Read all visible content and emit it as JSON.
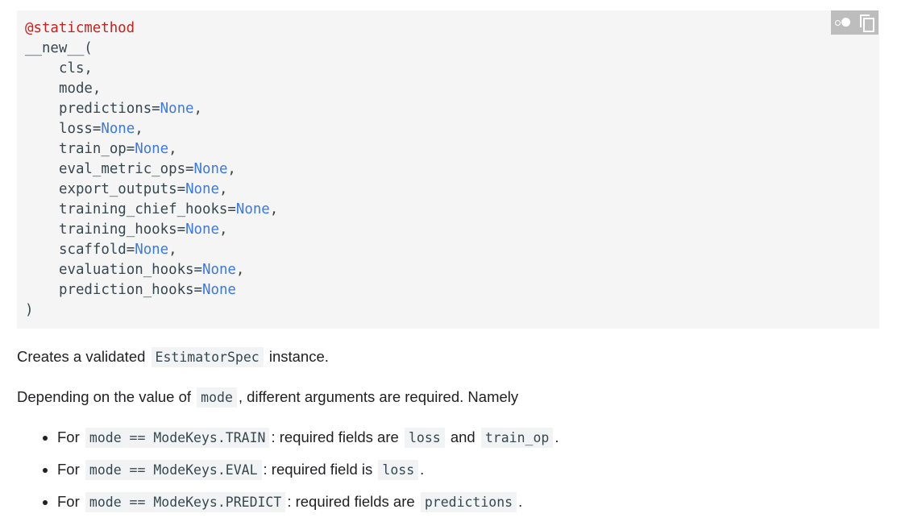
{
  "code": {
    "decorator": "@staticmethod",
    "func_open": "__new__(",
    "params": [
      {
        "name": "cls,",
        "default": "",
        "trail": ""
      },
      {
        "name": "mode,",
        "default": "",
        "trail": ""
      },
      {
        "name": "predictions=",
        "default": "None",
        "trail": ","
      },
      {
        "name": "loss=",
        "default": "None",
        "trail": ","
      },
      {
        "name": "train_op=",
        "default": "None",
        "trail": ","
      },
      {
        "name": "eval_metric_ops=",
        "default": "None",
        "trail": ","
      },
      {
        "name": "export_outputs=",
        "default": "None",
        "trail": ","
      },
      {
        "name": "training_chief_hooks=",
        "default": "None",
        "trail": ","
      },
      {
        "name": "training_hooks=",
        "default": "None",
        "trail": ","
      },
      {
        "name": "scaffold=",
        "default": "None",
        "trail": ","
      },
      {
        "name": "evaluation_hooks=",
        "default": "None",
        "trail": ","
      },
      {
        "name": "prediction_hooks=",
        "default": "None",
        "trail": ""
      }
    ],
    "func_close": ")"
  },
  "toolbar": {
    "theme_icon": "theme-toggle-icon",
    "copy_icon": "copy-icon"
  },
  "description": {
    "p1_before": "Creates a validated ",
    "p1_code": "EstimatorSpec",
    "p1_after": " instance.",
    "p2_before": "Depending on the value of ",
    "p2_code": "mode",
    "p2_after": ", different arguments are required. Namely"
  },
  "bullets": [
    {
      "prefix": "For ",
      "code": "mode == ModeKeys.TRAIN",
      "middle": ": required fields are ",
      "code2": "loss",
      "joiner": " and ",
      "code3": "train_op",
      "end": "."
    },
    {
      "prefix": "For ",
      "code": "mode == ModeKeys.EVAL",
      "middle": ": required field is ",
      "code2": "loss",
      "end": "."
    },
    {
      "prefix": "For ",
      "code": "mode == ModeKeys.PREDICT",
      "middle": ": required fields are ",
      "code2": "predictions",
      "end": "."
    }
  ]
}
